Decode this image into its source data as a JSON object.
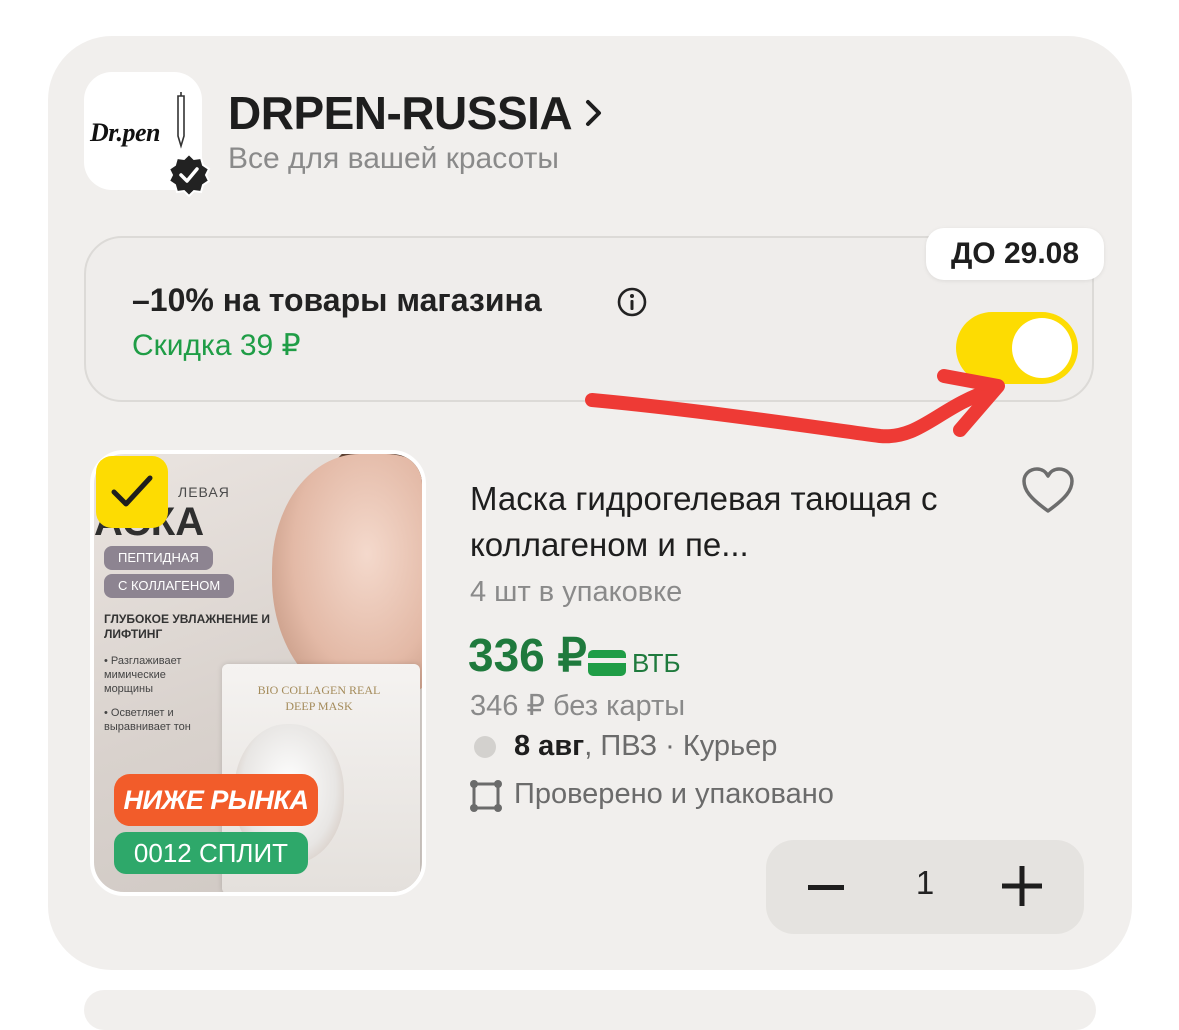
{
  "shop": {
    "logo_text": "Dr.pen",
    "name": "DRPEN-RUSSIA",
    "subtitle": "Все для вашей красоты"
  },
  "promo": {
    "title": "–10% на товары магазина",
    "discount": "Скидка 39 ₽",
    "valid_until": "ДО 29.08",
    "toggle_on": true
  },
  "product": {
    "selected": true,
    "title": "Маска гидрогелевая тающая с коллагеном и пе...",
    "pack": "4 шт в упаковке",
    "price": "336 ₽",
    "bank": "ВТБ",
    "old_price": "346 ₽  без карты",
    "delivery_date": "8 авг",
    "delivery_rest": ", ПВЗ · Курьер",
    "checked": "Проверено и упаковано",
    "quantity": "1",
    "badges": {
      "lower": "НИЖЕ РЫНКА",
      "split": "0012 СПЛИТ"
    },
    "image_text": {
      "t1": "ЛЕВАЯ",
      "t2": "АСКА",
      "pill1": "ПЕПТИДНАЯ",
      "pill2": "С КОЛЛАГЕНОМ",
      "t3": "ГЛУБОКОЕ УВЛАЖНЕНИЕ И ЛИФТИНГ",
      "t4": "• Разглаживает мимические морщины",
      "t5": "• Осветляет и выравнивает тон",
      "box": "BIO COLLAGEN REAL DEEP MASK"
    }
  },
  "colors": {
    "accent_yellow": "#fddc02",
    "price_green": "#1f7a3d",
    "discount_green": "#1f9d46",
    "arrow_red": "#ee3a35",
    "badge_orange": "#f25c2a"
  }
}
